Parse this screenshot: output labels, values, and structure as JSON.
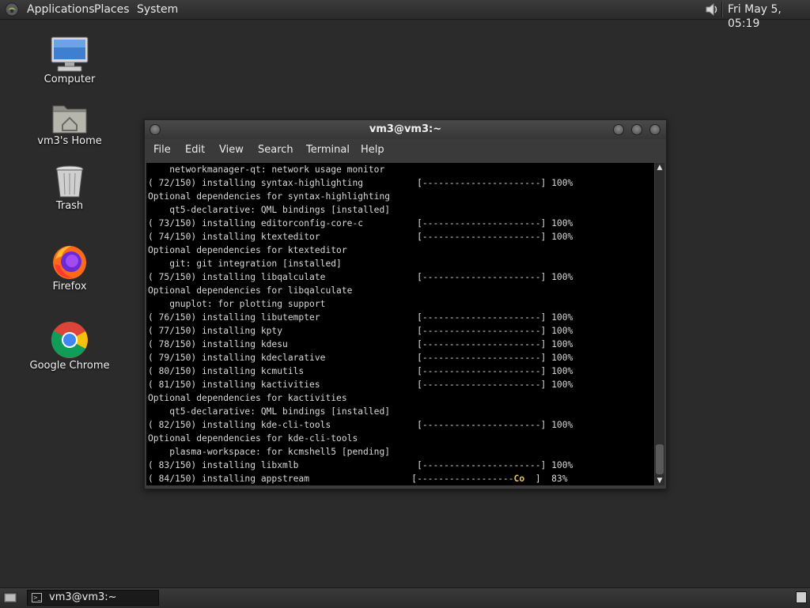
{
  "top_panel": {
    "menus": [
      "Applications",
      "Places",
      "System"
    ],
    "clock": "Fri May  5, 05:19",
    "logo_icon": "mate-logo-icon",
    "volume_icon": "speaker-icon"
  },
  "desktop": {
    "icons": [
      {
        "label": "Computer",
        "icon": "computer-icon"
      },
      {
        "label": "vm3's Home",
        "icon": "home-folder-icon"
      },
      {
        "label": "Trash",
        "icon": "trash-icon"
      },
      {
        "label": "Firefox",
        "icon": "firefox-icon"
      },
      {
        "label": "Google Chrome",
        "icon": "chrome-icon"
      }
    ]
  },
  "terminal_window": {
    "title": "vm3@vm3:~",
    "menu": [
      "File",
      "Edit",
      "View",
      "Search",
      "Terminal",
      "Help"
    ],
    "lines": [
      "    networkmanager-qt: network usage monitor",
      "( 72/150) installing syntax-highlighting          [----------------------] 100%",
      "Optional dependencies for syntax-highlighting",
      "    qt5-declarative: QML bindings [installed]",
      "( 73/150) installing editorconfig-core-c          [----------------------] 100%",
      "( 74/150) installing ktexteditor                  [----------------------] 100%",
      "Optional dependencies for ktexteditor",
      "    git: git integration [installed]",
      "( 75/150) installing libqalculate                 [----------------------] 100%",
      "Optional dependencies for libqalculate",
      "    gnuplot: for plotting support",
      "( 76/150) installing libutempter                  [----------------------] 100%",
      "( 77/150) installing kpty                         [----------------------] 100%",
      "( 78/150) installing kdesu                        [----------------------] 100%",
      "( 79/150) installing kdeclarative                 [----------------------] 100%",
      "( 80/150) installing kcmutils                     [----------------------] 100%",
      "( 81/150) installing kactivities                  [----------------------] 100%",
      "Optional dependencies for kactivities",
      "    qt5-declarative: QML bindings [installed]",
      "( 82/150) installing kde-cli-tools                [----------------------] 100%",
      "Optional dependencies for kde-cli-tools",
      "    plasma-workspace: for kcmshell5 [pending]",
      "( 83/150) installing libxmlb                      [----------------------] 100%"
    ],
    "last_line": {
      "prefix": "( 84/150) installing appstream                   [------------------",
      "pacman": "C",
      "dot": "o",
      "suffix": "  ]  83%"
    },
    "progress_percent": 83
  },
  "bottom_panel": {
    "task_label": "vm3@vm3:~",
    "show_desktop_icon": "show-desktop-icon",
    "workspace_icon": "workspace-switcher-icon"
  },
  "colors": {
    "desktop_bg": "#2b2b2b",
    "terminal_bg": "#000000",
    "terminal_fg": "#d9d9d9",
    "pacman": "#e8c34a"
  }
}
